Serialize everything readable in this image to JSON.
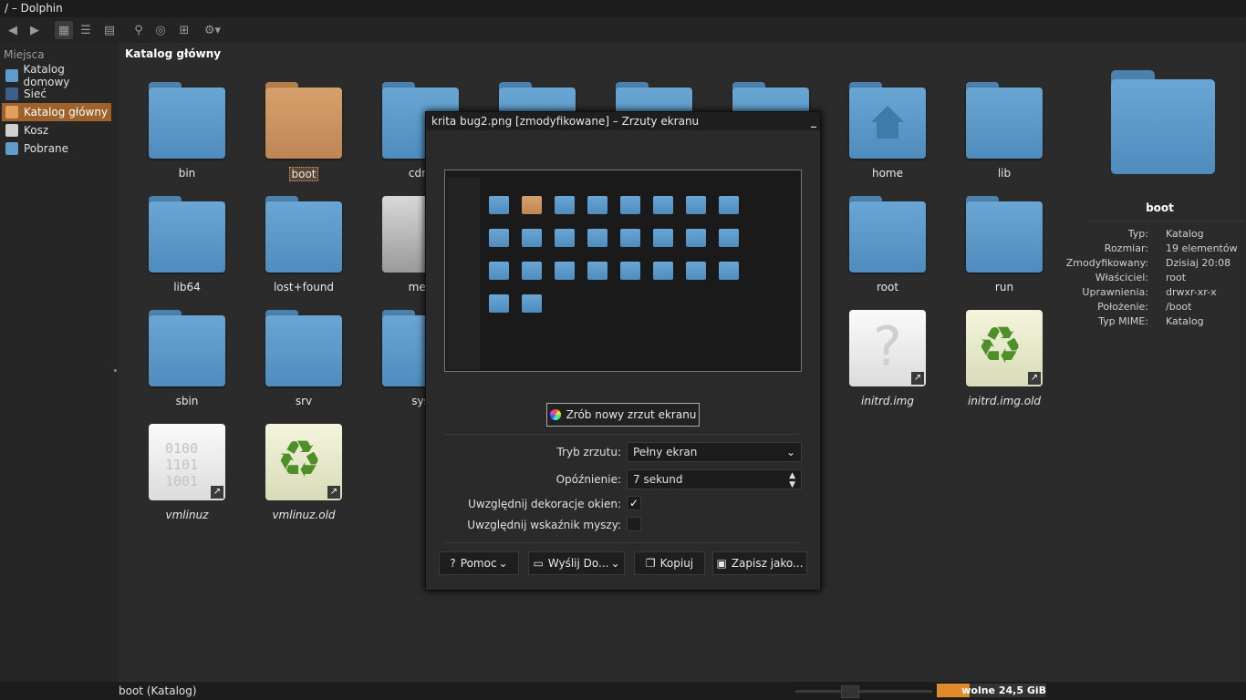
{
  "window": {
    "title": "/ – Dolphin"
  },
  "sidebar": {
    "header": "Miejsca",
    "items": [
      {
        "label": "Katalog domowy",
        "icon": "home-icon"
      },
      {
        "label": "Sieć",
        "icon": "network-icon"
      },
      {
        "label": "Katalog główny",
        "icon": "root-folder-icon",
        "selected": true
      },
      {
        "label": "Kosz",
        "icon": "trash-icon"
      },
      {
        "label": "Pobrane",
        "icon": "downloads-icon"
      }
    ]
  },
  "main": {
    "header": "Katalog główny",
    "files": [
      "bin",
      "boot",
      "cdro",
      "home",
      "lib",
      "lib64",
      "lost+found",
      "med",
      "root",
      "run",
      "sbin",
      "srv",
      "sys",
      "initrd.img",
      "initrd.img.old",
      "vmlinuz",
      "vmlinuz.old"
    ],
    "binary_text": [
      "0100",
      "1101",
      "1001"
    ]
  },
  "info_panel": {
    "name": "boot",
    "props": [
      {
        "k": "Typ:",
        "v": "Katalog"
      },
      {
        "k": "Rozmiar:",
        "v": "19 elementów"
      },
      {
        "k": "Zmodyfikowany:",
        "v": "Dzisiaj 20:08"
      },
      {
        "k": "Właściciel:",
        "v": "root"
      },
      {
        "k": "Uprawnienia:",
        "v": "drwxr-xr-x"
      },
      {
        "k": "Położenie:",
        "v": "/boot"
      },
      {
        "k": "Typ MIME:",
        "v": "Katalog"
      }
    ]
  },
  "status": {
    "text": "boot (Katalog)",
    "free_space": "wolne 24,5 GiB",
    "used_fraction": 0.3
  },
  "dialog": {
    "title": "krita bug2.png [zmodyfikowane] – Zrzuty ekranu",
    "new_shot": "Zrób nowy zrzut ekranu",
    "mode_label": "Tryb zrzutu:",
    "mode_value": "Pełny ekran",
    "delay_label": "Opóźnienie:",
    "delay_value": "7 sekund",
    "decor_label": "Uwzględnij dekoracje okien:",
    "decor_checked": true,
    "cursor_label": "Uwzględnij wskaźnik myszy:",
    "cursor_checked": false,
    "buttons": {
      "help": "Pomoc",
      "send": "Wyślij Do...",
      "copy": "Kopiuj",
      "save": "Zapisz jako..."
    }
  }
}
